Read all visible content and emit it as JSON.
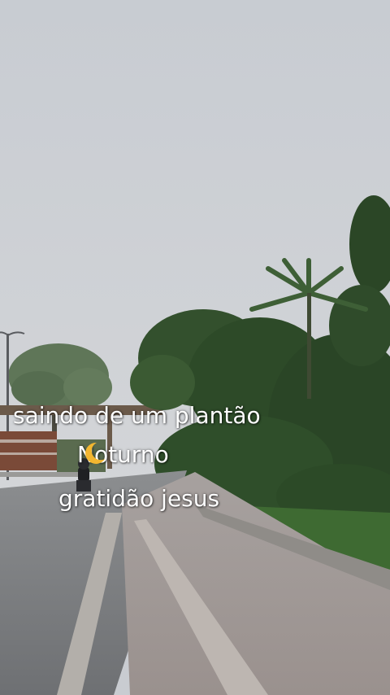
{
  "caption": {
    "line1": "saindo de um plantão",
    "line2": "Noturno",
    "line3": "gratidão jesus",
    "emoji": "crescent-moon"
  },
  "colors": {
    "sky": "#cdd0d4",
    "foliage": "#2f4a2a",
    "road": "#7d7f82",
    "sidewalk": "#a39b98",
    "text": "#ffffff"
  }
}
